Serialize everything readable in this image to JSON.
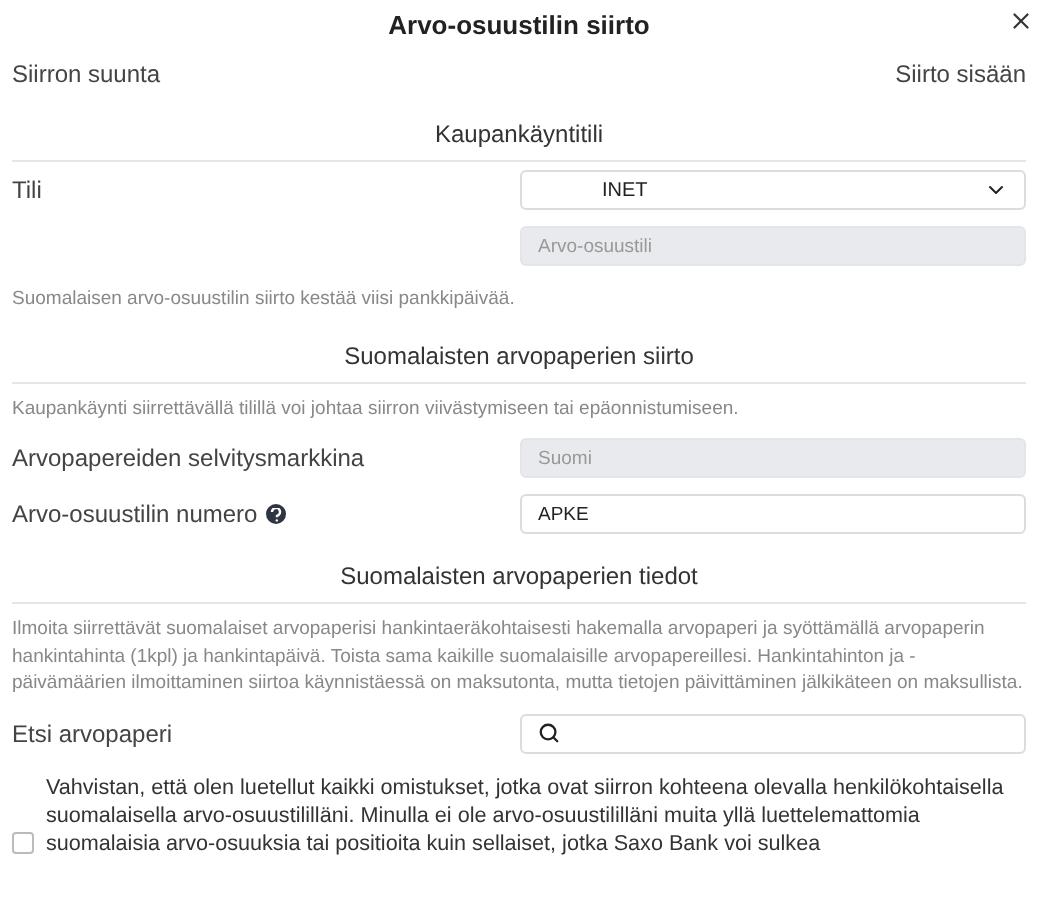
{
  "dialog": {
    "title": "Arvo-osuustilin siirto"
  },
  "direction": {
    "label": "Siirron suunta",
    "value": "Siirto sisään"
  },
  "sections": [
    {
      "title": "Kaupankäyntitili",
      "rows": [
        {
          "kind": "select",
          "label": "Tili",
          "value": "INET"
        },
        {
          "kind": "disabled",
          "label": null,
          "placeholder": "Arvo-osuustili"
        }
      ],
      "footnote": "Suomalaisen arvo-osuustilin siirto kestää viisi pankkipäivää."
    },
    {
      "title": "Suomalaisten arvopaperien siirto",
      "note": "Kaupankäynti siirrettävällä tilillä voi johtaa siirron viivästymiseen tai epäonnistumiseen.",
      "rows": [
        {
          "kind": "disabled",
          "label": "Arvopapereiden selvitysmarkkina",
          "placeholder": "Suomi"
        },
        {
          "kind": "text",
          "label": "Arvo-osuustilin numero",
          "help": true,
          "value": "APKE"
        }
      ]
    },
    {
      "title": "Suomalaisten arvopaperien tiedot",
      "note": "Ilmoita siirrettävät suomalaiset arvopaperisi hankintaeräkohtaisesti hakemalla arvopaperi ja syöttämällä arvopaperin hankintahinta (1kpl) ja hankintapäivä. Toista sama kaikille suomalaisille arvopapereillesi. Hankintahinton ja -päivämäärien ilmoittaminen siirtoa käynnistäessä on maksutonta, mutta tietojen päivittäminen jälkikäteen on maksullista.",
      "rows": [
        {
          "kind": "search",
          "label": "Etsi arvopaperi"
        }
      ]
    }
  ],
  "confirmation": {
    "checked": false,
    "text": "Vahvistan, että olen luetellut kaikki omistukset, jotka ovat siirron kohteena olevalla henkilökohtaisella suomalaisella arvo-osuustililläni. Minulla ei ole arvo-osuustililläni muita yllä luettelemattomia suomalaisia arvo-osuuksia tai positioita kuin sellaiset, jotka Saxo Bank voi sulkea"
  }
}
